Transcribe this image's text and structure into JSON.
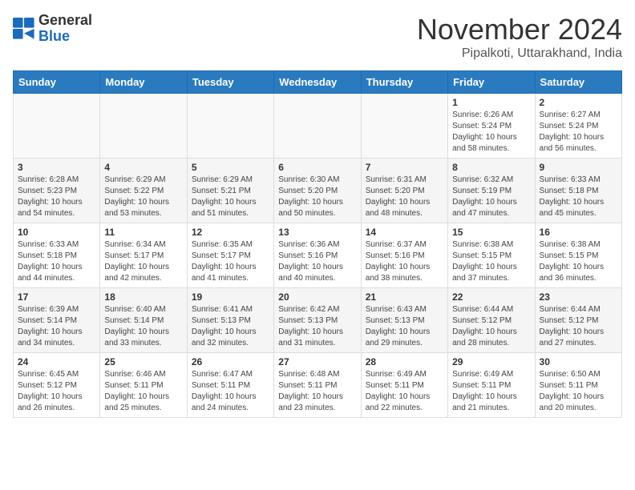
{
  "header": {
    "logo_general": "General",
    "logo_blue": "Blue",
    "title": "November 2024",
    "subtitle": "Pipalkoti, Uttarakhand, India"
  },
  "columns": [
    "Sunday",
    "Monday",
    "Tuesday",
    "Wednesday",
    "Thursday",
    "Friday",
    "Saturday"
  ],
  "weeks": [
    [
      {
        "day": "",
        "info": ""
      },
      {
        "day": "",
        "info": ""
      },
      {
        "day": "",
        "info": ""
      },
      {
        "day": "",
        "info": ""
      },
      {
        "day": "",
        "info": ""
      },
      {
        "day": "1",
        "info": "Sunrise: 6:26 AM\nSunset: 5:24 PM\nDaylight: 10 hours and 58 minutes."
      },
      {
        "day": "2",
        "info": "Sunrise: 6:27 AM\nSunset: 5:24 PM\nDaylight: 10 hours and 56 minutes."
      }
    ],
    [
      {
        "day": "3",
        "info": "Sunrise: 6:28 AM\nSunset: 5:23 PM\nDaylight: 10 hours and 54 minutes."
      },
      {
        "day": "4",
        "info": "Sunrise: 6:29 AM\nSunset: 5:22 PM\nDaylight: 10 hours and 53 minutes."
      },
      {
        "day": "5",
        "info": "Sunrise: 6:29 AM\nSunset: 5:21 PM\nDaylight: 10 hours and 51 minutes."
      },
      {
        "day": "6",
        "info": "Sunrise: 6:30 AM\nSunset: 5:20 PM\nDaylight: 10 hours and 50 minutes."
      },
      {
        "day": "7",
        "info": "Sunrise: 6:31 AM\nSunset: 5:20 PM\nDaylight: 10 hours and 48 minutes."
      },
      {
        "day": "8",
        "info": "Sunrise: 6:32 AM\nSunset: 5:19 PM\nDaylight: 10 hours and 47 minutes."
      },
      {
        "day": "9",
        "info": "Sunrise: 6:33 AM\nSunset: 5:18 PM\nDaylight: 10 hours and 45 minutes."
      }
    ],
    [
      {
        "day": "10",
        "info": "Sunrise: 6:33 AM\nSunset: 5:18 PM\nDaylight: 10 hours and 44 minutes."
      },
      {
        "day": "11",
        "info": "Sunrise: 6:34 AM\nSunset: 5:17 PM\nDaylight: 10 hours and 42 minutes."
      },
      {
        "day": "12",
        "info": "Sunrise: 6:35 AM\nSunset: 5:17 PM\nDaylight: 10 hours and 41 minutes."
      },
      {
        "day": "13",
        "info": "Sunrise: 6:36 AM\nSunset: 5:16 PM\nDaylight: 10 hours and 40 minutes."
      },
      {
        "day": "14",
        "info": "Sunrise: 6:37 AM\nSunset: 5:16 PM\nDaylight: 10 hours and 38 minutes."
      },
      {
        "day": "15",
        "info": "Sunrise: 6:38 AM\nSunset: 5:15 PM\nDaylight: 10 hours and 37 minutes."
      },
      {
        "day": "16",
        "info": "Sunrise: 6:38 AM\nSunset: 5:15 PM\nDaylight: 10 hours and 36 minutes."
      }
    ],
    [
      {
        "day": "17",
        "info": "Sunrise: 6:39 AM\nSunset: 5:14 PM\nDaylight: 10 hours and 34 minutes."
      },
      {
        "day": "18",
        "info": "Sunrise: 6:40 AM\nSunset: 5:14 PM\nDaylight: 10 hours and 33 minutes."
      },
      {
        "day": "19",
        "info": "Sunrise: 6:41 AM\nSunset: 5:13 PM\nDaylight: 10 hours and 32 minutes."
      },
      {
        "day": "20",
        "info": "Sunrise: 6:42 AM\nSunset: 5:13 PM\nDaylight: 10 hours and 31 minutes."
      },
      {
        "day": "21",
        "info": "Sunrise: 6:43 AM\nSunset: 5:13 PM\nDaylight: 10 hours and 29 minutes."
      },
      {
        "day": "22",
        "info": "Sunrise: 6:44 AM\nSunset: 5:12 PM\nDaylight: 10 hours and 28 minutes."
      },
      {
        "day": "23",
        "info": "Sunrise: 6:44 AM\nSunset: 5:12 PM\nDaylight: 10 hours and 27 minutes."
      }
    ],
    [
      {
        "day": "24",
        "info": "Sunrise: 6:45 AM\nSunset: 5:12 PM\nDaylight: 10 hours and 26 minutes."
      },
      {
        "day": "25",
        "info": "Sunrise: 6:46 AM\nSunset: 5:11 PM\nDaylight: 10 hours and 25 minutes."
      },
      {
        "day": "26",
        "info": "Sunrise: 6:47 AM\nSunset: 5:11 PM\nDaylight: 10 hours and 24 minutes."
      },
      {
        "day": "27",
        "info": "Sunrise: 6:48 AM\nSunset: 5:11 PM\nDaylight: 10 hours and 23 minutes."
      },
      {
        "day": "28",
        "info": "Sunrise: 6:49 AM\nSunset: 5:11 PM\nDaylight: 10 hours and 22 minutes."
      },
      {
        "day": "29",
        "info": "Sunrise: 6:49 AM\nSunset: 5:11 PM\nDaylight: 10 hours and 21 minutes."
      },
      {
        "day": "30",
        "info": "Sunrise: 6:50 AM\nSunset: 5:11 PM\nDaylight: 10 hours and 20 minutes."
      }
    ]
  ]
}
